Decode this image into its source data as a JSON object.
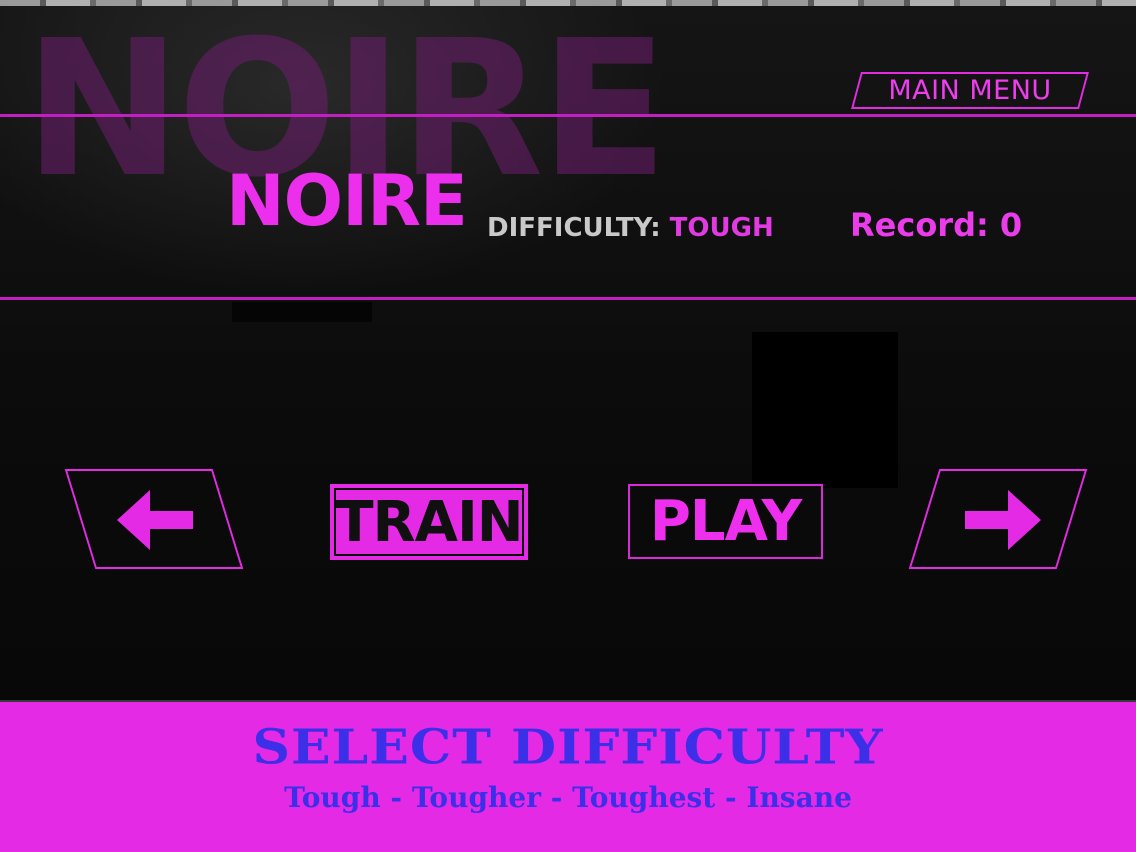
{
  "game": {
    "background_title": "NOIRE",
    "main_menu_label": "MAIN MENU",
    "stage_title": "NOIRE",
    "difficulty_label": "DIFFICULTY:",
    "difficulty_value": "TOUGH",
    "record_label": "Record: 0"
  },
  "controls": {
    "prev_icon": "left-arrow-icon",
    "next_icon": "right-arrow-icon",
    "train_label": "TRAIN",
    "play_label": "PLAY"
  },
  "difficulty_panel": {
    "heading": "SELECT DIFFICULTY",
    "levels": [
      "Tough",
      "Tougher",
      "Toughest",
      "Insane"
    ],
    "separator": " - "
  },
  "colors": {
    "accent": "#e52ae5",
    "panel_text": "#3b2fe8",
    "background": "#0a0a0a"
  }
}
